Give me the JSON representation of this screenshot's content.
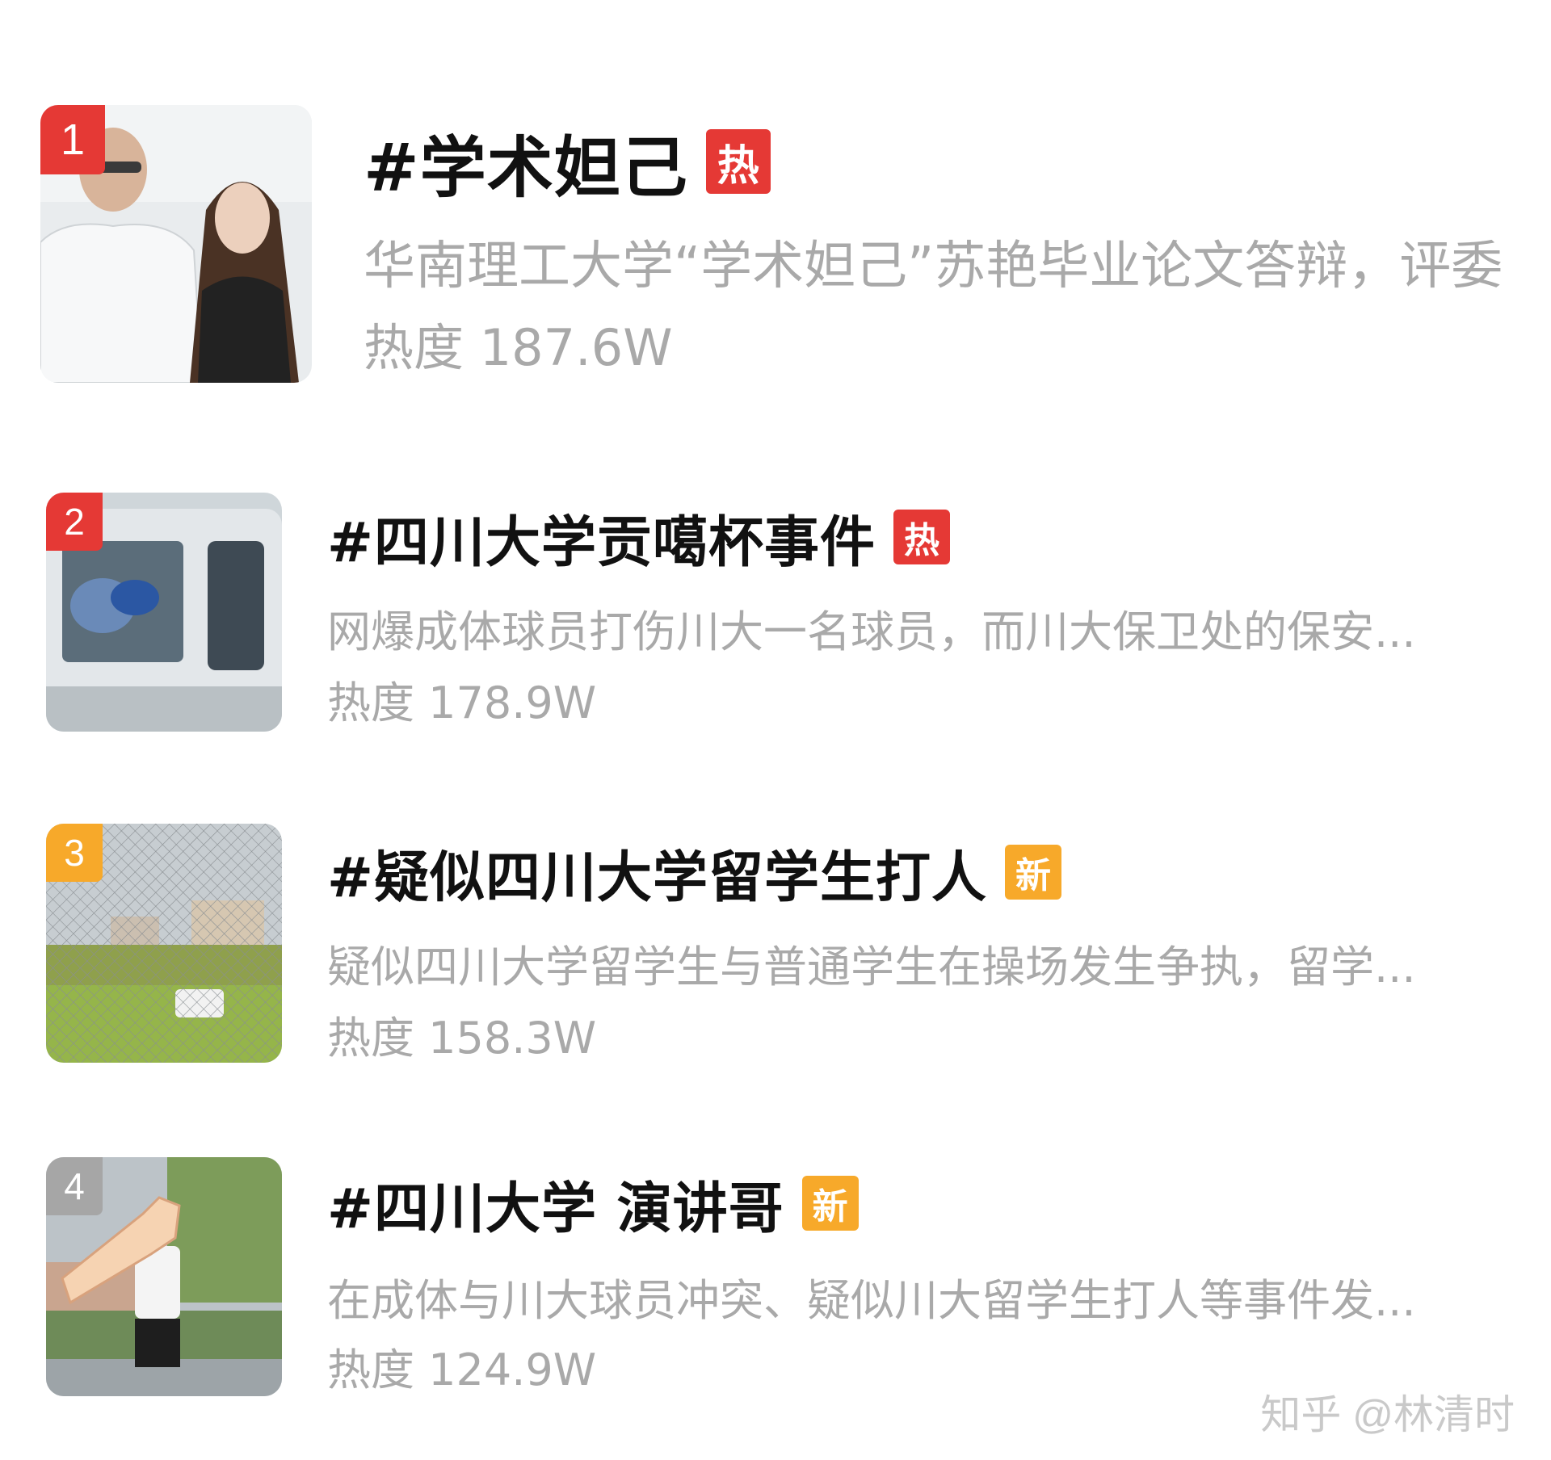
{
  "colors": {
    "hot_badge": "#e53935",
    "new_badge": "#f7a92a",
    "rank_1": "#e53935",
    "rank_2": "#e53935",
    "rank_3": "#f7a92a",
    "rank_4": "#a6a6a6",
    "title": "#111111",
    "secondary": "#a9a9a9"
  },
  "trending": [
    {
      "rank": "1",
      "title": "#学术妲己",
      "badge": "热",
      "badge_type": "hot",
      "desc": "华南理工大学“学术妲己”苏艳毕业论文答辩，评委",
      "heat": "热度 187.6W"
    },
    {
      "rank": "2",
      "title": "#四川大学贡噶杯事件",
      "badge": "热",
      "badge_type": "hot",
      "desc": "网爆成体球员打伤川大一名球员，而川大保卫处的保安...",
      "heat": "热度 178.9W"
    },
    {
      "rank": "3",
      "title": "#疑似四川大学留学生打人",
      "badge": "新",
      "badge_type": "new",
      "desc": "疑似四川大学留学生与普通学生在操场发生争执，留学...",
      "heat": "热度 158.3W"
    },
    {
      "rank": "4",
      "title": "#四川大学 演讲哥",
      "badge": "新",
      "badge_type": "new",
      "desc": "在成体与川大球员冲突、疑似川大留学生打人等事件发...",
      "heat": "热度 124.9W"
    }
  ],
  "watermark": "知乎 @林清时"
}
